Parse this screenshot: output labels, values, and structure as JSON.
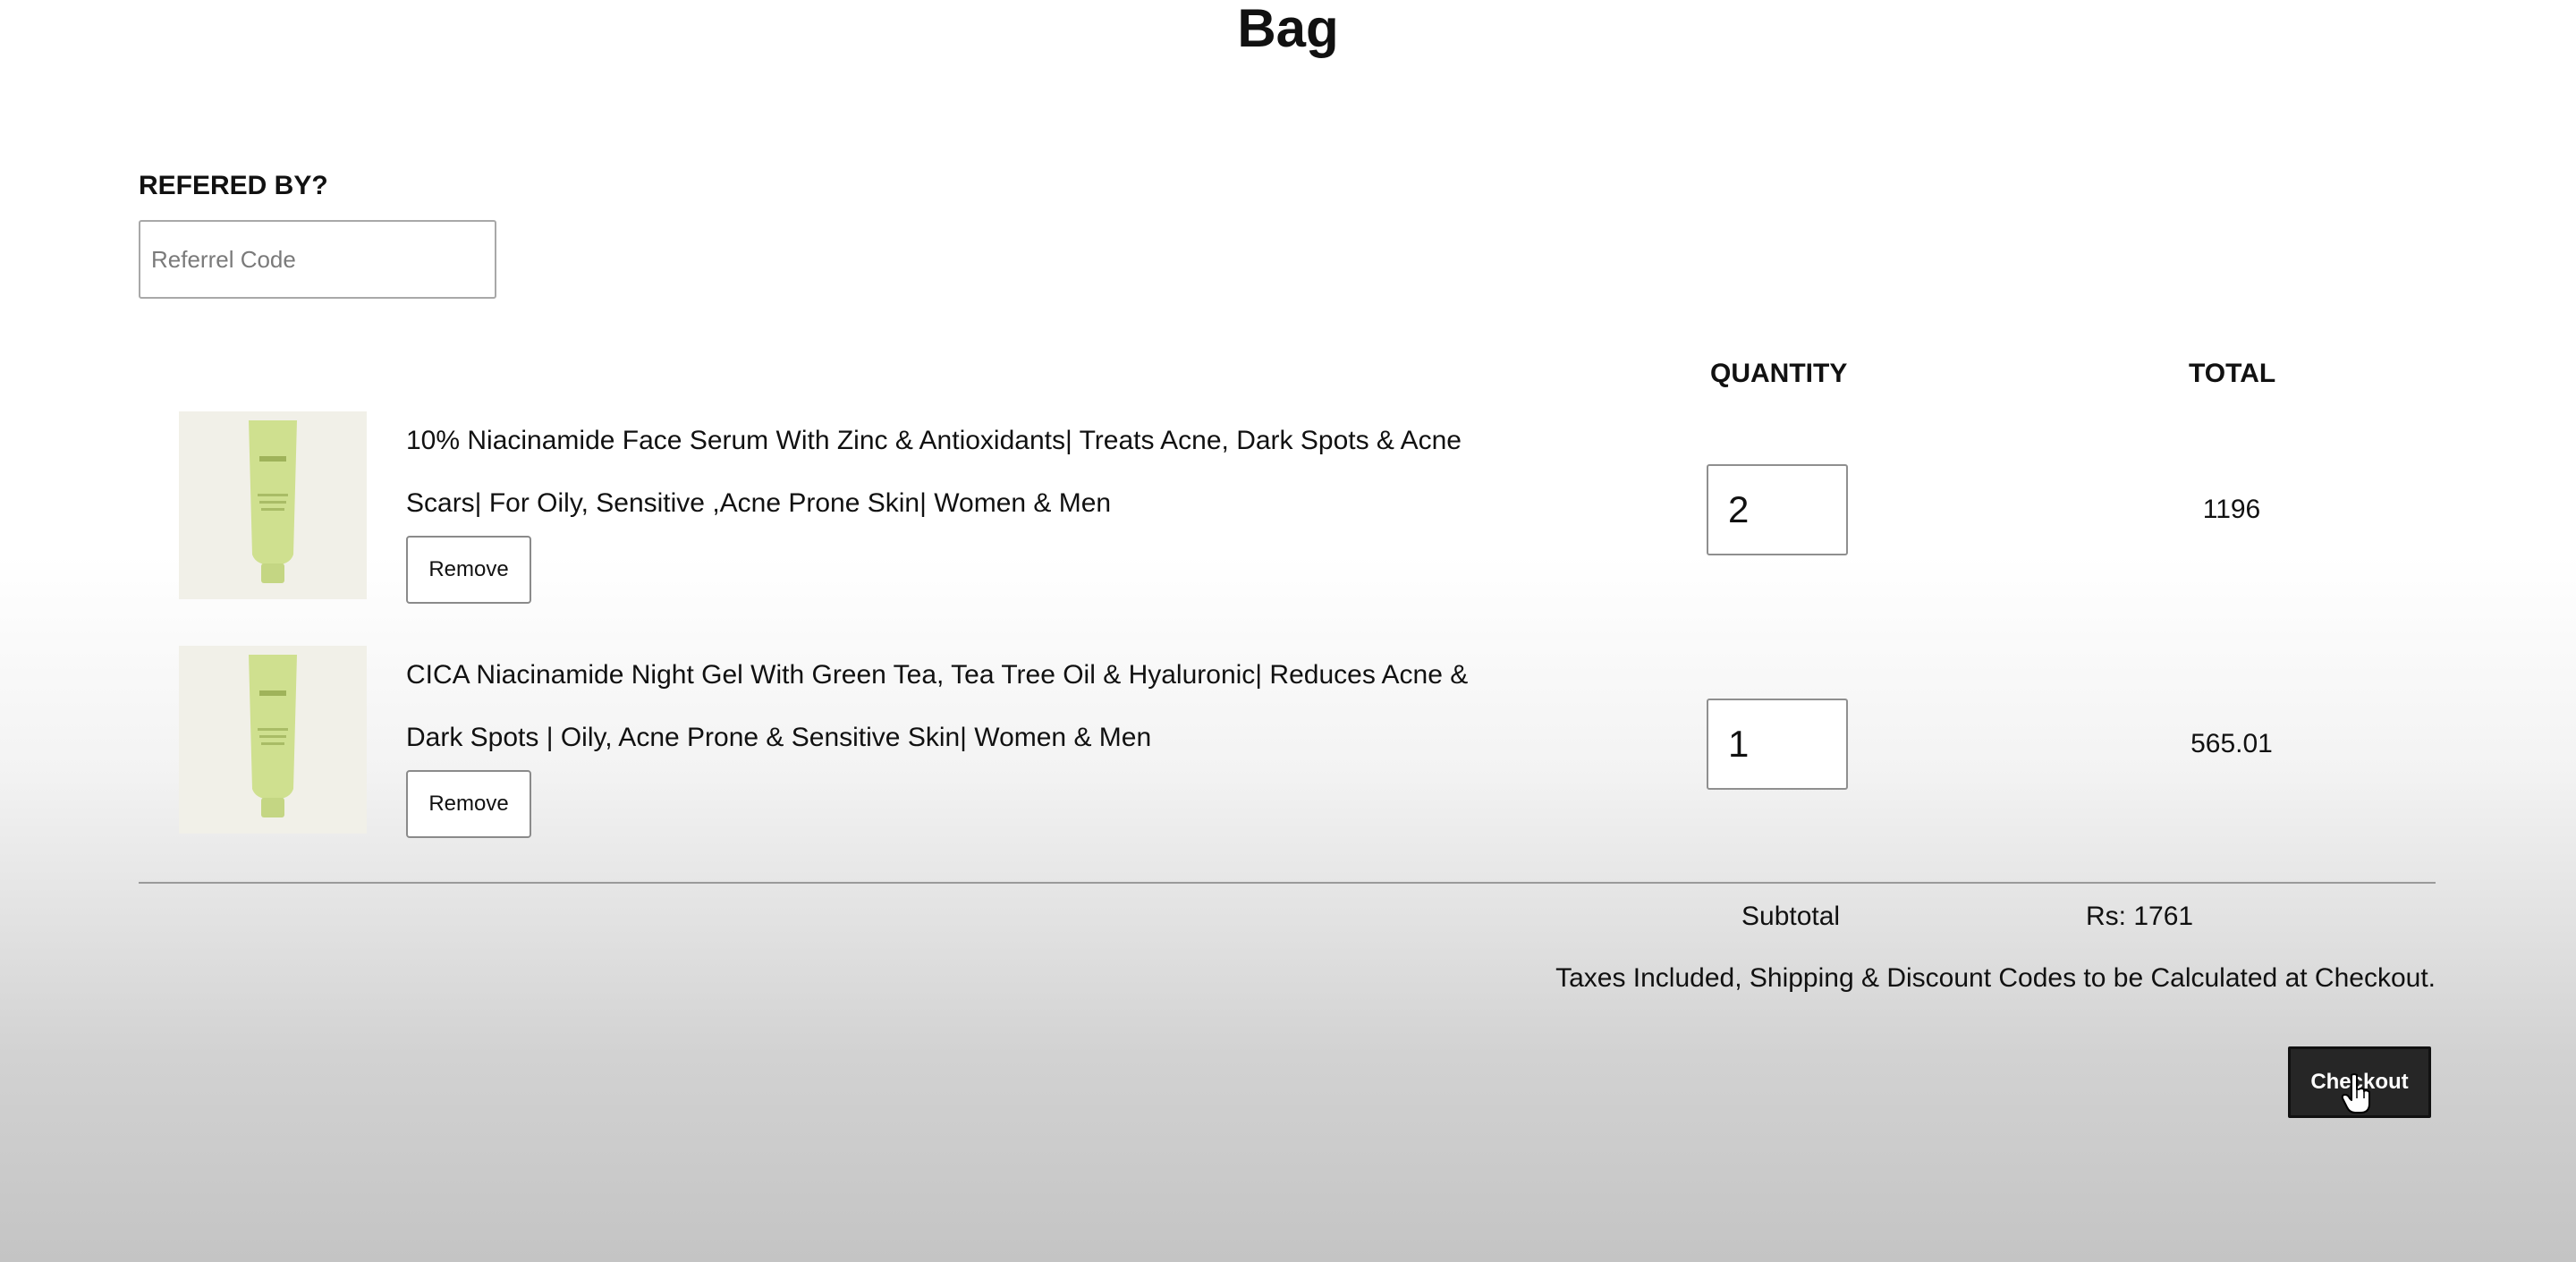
{
  "page": {
    "title": "Bag"
  },
  "referral": {
    "label": "REFERED BY?",
    "placeholder": "Referrel Code",
    "value": ""
  },
  "columns": {
    "quantity": "QUANTITY",
    "total": "TOTAL"
  },
  "items": [
    {
      "title": "10% Niacinamide Face Serum With Zinc & Antioxidants| Treats Acne, Dark Spots & Acne Scars| For Oily, Sensitive ,Acne Prone Skin| Women & Men",
      "quantity": "2",
      "total": "1196",
      "remove_label": "Remove",
      "image_icon": "product-tube-icon"
    },
    {
      "title": "CICA Niacinamide Night Gel With Green Tea, Tea Tree Oil & Hyaluronic| Reduces Acne & Dark Spots | Oily, Acne Prone & Sensitive Skin| Women & Men",
      "quantity": "1",
      "total": "565.01",
      "remove_label": "Remove",
      "image_icon": "product-tube-icon"
    }
  ],
  "summary": {
    "subtotal_label": "Subtotal",
    "subtotal_value": "Rs: 1761",
    "tax_note": "Taxes Included, Shipping & Discount Codes to be Calculated at Checkout.",
    "checkout_label": "Checkout"
  },
  "cursor": {
    "icon": "hand-pointer-icon"
  },
  "colors": {
    "checkout_bg": "#262626",
    "product_tube": "#cfe08f",
    "product_bg": "#f1f0e8"
  }
}
